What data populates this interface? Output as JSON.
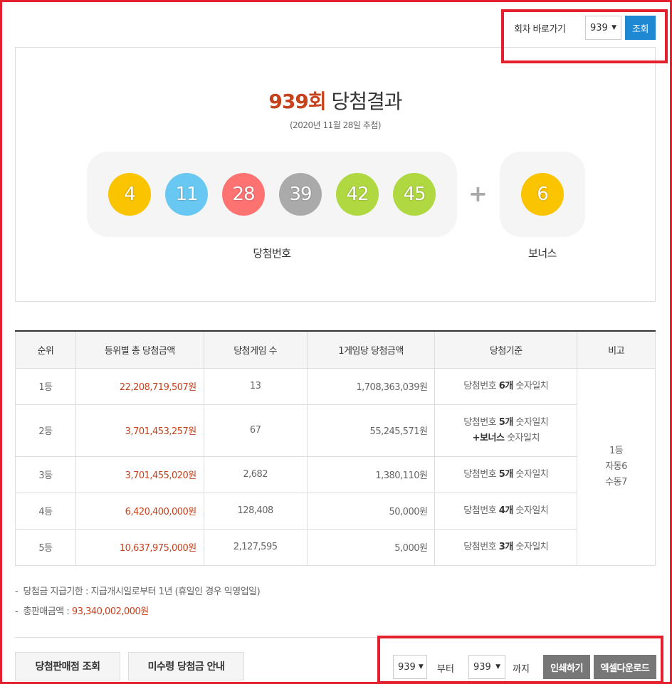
{
  "goto": {
    "label": "회차 바로가기",
    "selected": "939",
    "button": "조회"
  },
  "result": {
    "round": "939회",
    "title_suffix": " 당첨결과",
    "date": "(2020년 11월 28일 추첨)",
    "numbers": [
      {
        "value": "4",
        "color": "#fbc400"
      },
      {
        "value": "11",
        "color": "#69c8f2"
      },
      {
        "value": "28",
        "color": "#ff7272"
      },
      {
        "value": "39",
        "color": "#aaaaaa"
      },
      {
        "value": "42",
        "color": "#b0d840"
      },
      {
        "value": "45",
        "color": "#b0d840"
      }
    ],
    "plus": "+",
    "bonus": {
      "value": "6",
      "color": "#fbc400"
    },
    "numbers_caption": "당첨번호",
    "bonus_caption": "보너스"
  },
  "table": {
    "headers": [
      "순위",
      "등위별 총 당첨금액",
      "당첨게임 수",
      "1게임당 당첨금액",
      "당첨기준",
      "비고"
    ],
    "rows": [
      {
        "rank": "1등",
        "total": "22,208,719,507원",
        "winners": "13",
        "per_game": "1,708,363,039원",
        "cond_pre": "당첨번호 ",
        "cond_bold": "6개",
        "cond_post": " 숫자일치"
      },
      {
        "rank": "2등",
        "total": "3,701,453,257원",
        "winners": "67",
        "per_game": "55,245,571원",
        "cond_pre": "당첨번호 ",
        "cond_bold": "5개",
        "cond_post": " 숫자일치",
        "cond2_bold": "+보너스",
        "cond2_post": " 숫자일치"
      },
      {
        "rank": "3등",
        "total": "3,701,455,020원",
        "winners": "2,682",
        "per_game": "1,380,110원",
        "cond_pre": "당첨번호 ",
        "cond_bold": "5개",
        "cond_post": " 숫자일치"
      },
      {
        "rank": "4등",
        "total": "6,420,400,000원",
        "winners": "128,408",
        "per_game": "50,000원",
        "cond_pre": "당첨번호 ",
        "cond_bold": "4개",
        "cond_post": " 숫자일치"
      },
      {
        "rank": "5등",
        "total": "10,637,975,000원",
        "winners": "2,127,595",
        "per_game": "5,000원",
        "cond_pre": "당첨번호 ",
        "cond_bold": "3개",
        "cond_post": " 숫자일치"
      }
    ],
    "remarks": [
      "1등",
      "자동6",
      "수동7"
    ]
  },
  "notes": {
    "payment_period": "당첨금 지급기한 : 지급개시일로부터 1년 (휴일인 경우 익영업일)",
    "total_sales_label": "총판매금액 : ",
    "total_sales_value": "93,340,002,000원"
  },
  "actions": {
    "store_search": "당첨판매점 조회",
    "minor_guide": "미수령 당첨금 안내",
    "from_value": "939",
    "from_label": "부터",
    "to_value": "939",
    "to_label": "까지",
    "print": "인쇄하기",
    "excel": "엑셀다운로드"
  },
  "colors": {
    "accent_red": "#c6421d",
    "button_blue": "#1e88d2",
    "highlight_frame": "#e5202e"
  }
}
